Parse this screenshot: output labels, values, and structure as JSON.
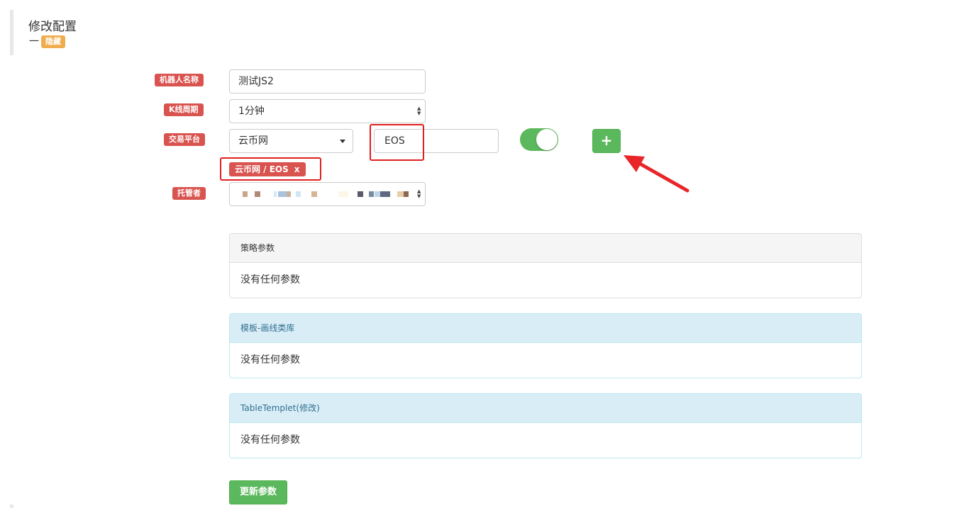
{
  "header": {
    "title": "修改配置",
    "dash": "一",
    "hide_badge": "隐藏"
  },
  "form": {
    "robot_name": {
      "label": "机器人名称",
      "value": "测试JS2"
    },
    "kline_period": {
      "label": "K线周期",
      "value": "1分钟"
    },
    "exchange": {
      "label": "交易平台",
      "platform_value": "云币网",
      "symbol_value": "EOS",
      "toggle_on": true,
      "add_icon": "plus-icon",
      "add_label": "+"
    },
    "pair_tag": {
      "text": "云币网 / EOS",
      "remove": "x"
    },
    "host": {
      "label": "托管者"
    }
  },
  "panels": [
    {
      "title": "策略参数",
      "body": "没有任何参数",
      "style": "default"
    },
    {
      "title": "模板-画线类库",
      "body": "没有任何参数",
      "style": "info"
    },
    {
      "title": "TableTemplet(修改)",
      "body": "没有任何参数",
      "style": "info"
    }
  ],
  "actions": {
    "update_label": "更新参数"
  },
  "colors": {
    "label_red": "#d9534f",
    "badge_orange": "#f0ad4e",
    "success_green": "#5cb85c",
    "info_bg": "#d9edf7",
    "annotation_red": "#e02020"
  }
}
